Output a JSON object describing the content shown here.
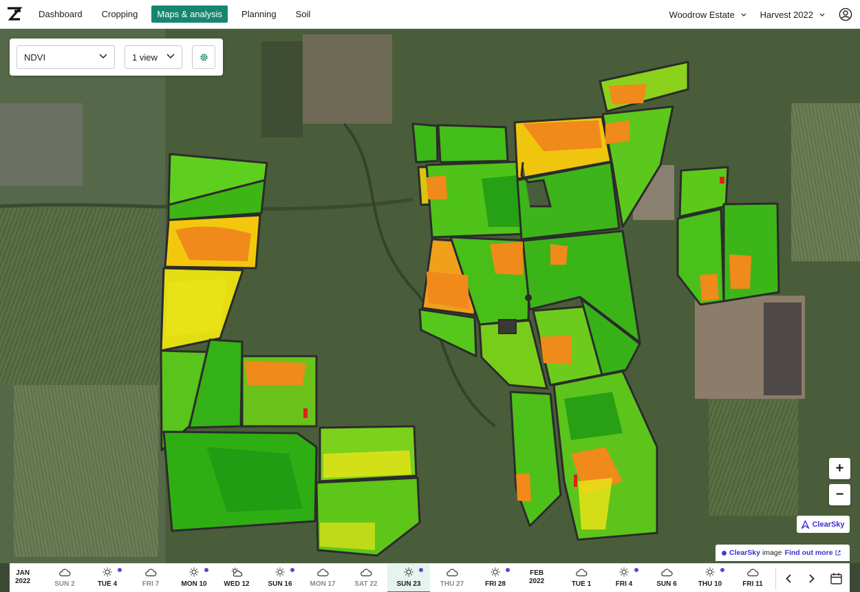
{
  "nav": {
    "items": [
      "Dashboard",
      "Cropping",
      "Maps & analysis",
      "Planning",
      "Soil"
    ],
    "active_index": 2,
    "estate": "Woodrow Estate",
    "harvest": "Harvest 2022"
  },
  "controls": {
    "layer": "NDVI",
    "views": "1 view"
  },
  "zoom": {
    "in": "+",
    "out": "−"
  },
  "clearsky_button": "ClearSky",
  "attribution": {
    "brand": "ClearSky",
    "text": "image",
    "link": "Find out more"
  },
  "timeline": {
    "months": [
      {
        "name": "JAN",
        "year": "2022"
      },
      {
        "name": "FEB",
        "year": "2022"
      }
    ],
    "days": [
      {
        "label": "SUN 2",
        "icon": "cloud",
        "mark": false,
        "dim": true
      },
      {
        "label": "TUE 4",
        "icon": "sun",
        "mark": true,
        "dim": false
      },
      {
        "label": "FRI 7",
        "icon": "cloud",
        "mark": false,
        "dim": true
      },
      {
        "label": "MON 10",
        "icon": "sun",
        "mark": true,
        "dim": false
      },
      {
        "label": "WED 12",
        "icon": "partly-cloudy",
        "mark": false,
        "dim": false
      },
      {
        "label": "SUN 16",
        "icon": "sun",
        "mark": true,
        "dim": false
      },
      {
        "label": "MON 17",
        "icon": "cloud",
        "mark": false,
        "dim": true
      },
      {
        "label": "SAT 22",
        "icon": "cloud",
        "mark": false,
        "dim": true
      },
      {
        "label": "SUN 23",
        "icon": "sun",
        "mark": true,
        "dim": false,
        "selected": true
      },
      {
        "label": "THU 27",
        "icon": "cloud",
        "mark": false,
        "dim": true
      },
      {
        "label": "FRI 28",
        "icon": "sun",
        "mark": true,
        "dim": false
      },
      {
        "label": "TUE 1",
        "icon": "cloud",
        "mark": false,
        "dim": false
      },
      {
        "label": "FRI 4",
        "icon": "sun",
        "mark": true,
        "dim": false
      },
      {
        "label": "SUN 6",
        "icon": "cloud",
        "mark": false,
        "dim": false
      },
      {
        "label": "THU 10",
        "icon": "sun",
        "mark": true,
        "dim": false
      },
      {
        "label": "FRI 11",
        "icon": "cloud",
        "mark": false,
        "dim": false
      }
    ]
  },
  "colors": {
    "brand": "#16866f",
    "ndvi_high": "#2db51f",
    "ndvi_dark": "#1e9a14",
    "ndvi_mid": "#e3e30a",
    "ndvi_low": "#f08a1a",
    "ndvi_min": "#e0201a",
    "clearsky": "#3a2fd0"
  }
}
